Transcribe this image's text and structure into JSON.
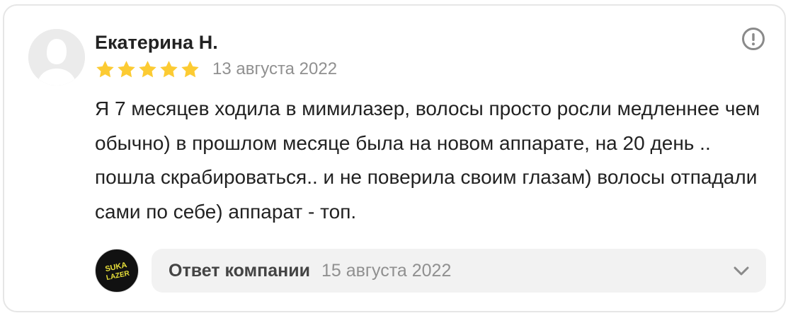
{
  "review": {
    "author": "Екатерина Н.",
    "rating": 5,
    "rating_max": 5,
    "date": "13 августа 2022",
    "text": "Я 7 месяцев ходила в мимилазер, волосы просто росли медленнее чем обычно) в прошлом месяце была на новом аппарате, на 20 день .. пошла скрабироваться.. и не поверила своим глазам) волосы отпадали сами по себе) аппарат - топ."
  },
  "company_reply": {
    "logo_text_line1": "SUKA",
    "logo_text_line2": "LAZER",
    "label": "Ответ компании",
    "date": "15 августа 2022"
  },
  "icons": {
    "avatar": "user-silhouette-icon",
    "star": "star-icon",
    "report": "exclamation-circle-icon",
    "expand": "chevron-down-icon"
  },
  "colors": {
    "star": "#FCCB33",
    "text": "#222222",
    "muted": "#909090",
    "reply_bg": "#F2F2F2",
    "logo_bg": "#111111",
    "logo_text": "#E8E03A"
  }
}
